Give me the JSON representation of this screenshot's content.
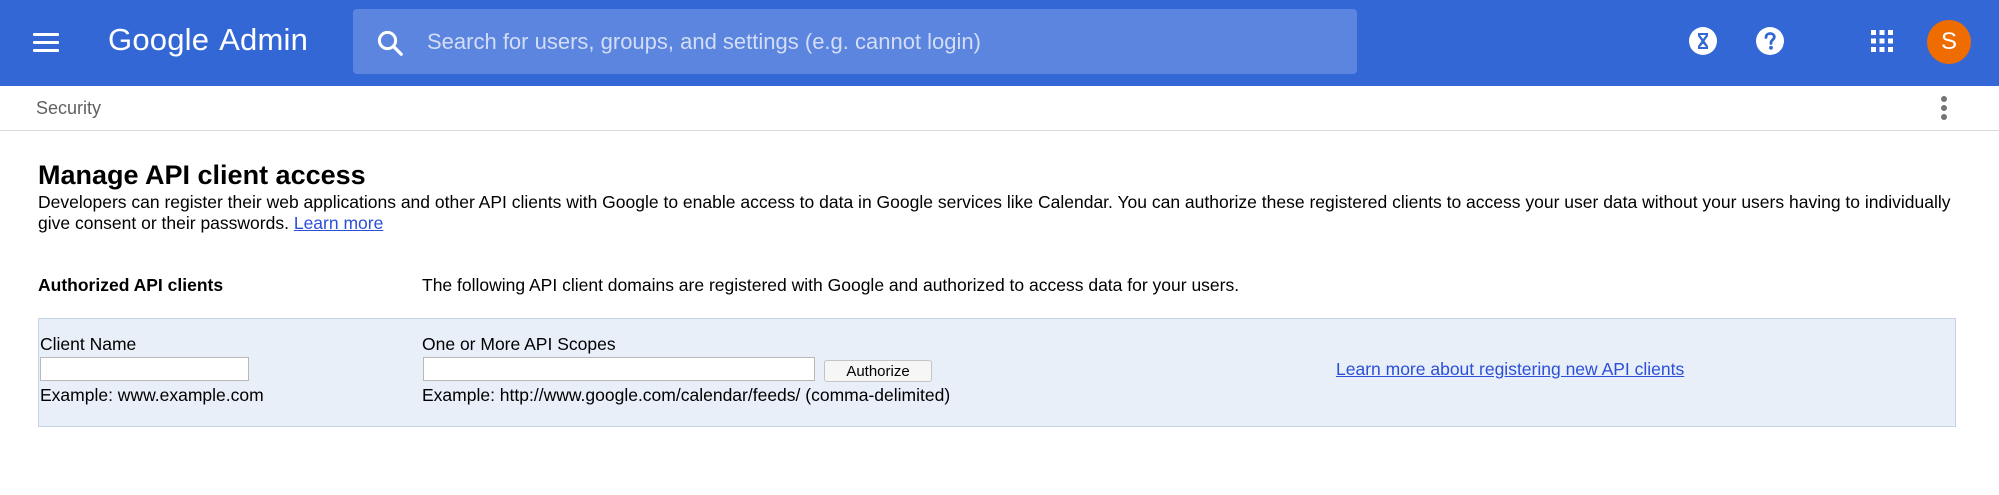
{
  "header": {
    "brand_google": "Google",
    "brand_admin": "Admin",
    "search_placeholder": "Search for users, groups, and settings (e.g. cannot login)",
    "avatar_initial": "S",
    "colors": {
      "bar": "#3367d6",
      "search": "#5c85df",
      "avatar": "#ef6c00"
    },
    "icons": [
      "menu-icon",
      "search-icon",
      "hourglass-icon",
      "help-icon",
      "apps-grid-icon"
    ]
  },
  "breadcrumb": {
    "label": "Security",
    "more_icon": "more-vert-icon"
  },
  "main": {
    "title": "Manage API client access",
    "description": "Developers can register their web applications and other API clients with Google to enable access to data in Google services like Calendar. You can authorize these registered clients to access your user data without your users having to individually give consent or their passwords.",
    "learn_more": "Learn more",
    "section_label": "Authorized API clients",
    "section_text": "The following API client domains are registered with Google and authorized to access data for your users.",
    "form": {
      "client_name_label": "Client Name",
      "client_name_value": "",
      "client_name_example": "Example: www.example.com",
      "scopes_label": "One or More API Scopes",
      "scopes_value": "",
      "scopes_example": "Example: http://www.google.com/calendar/feeds/ (comma-delimited)",
      "authorize_label": "Authorize",
      "learn_register": "Learn more about registering new API clients"
    }
  }
}
